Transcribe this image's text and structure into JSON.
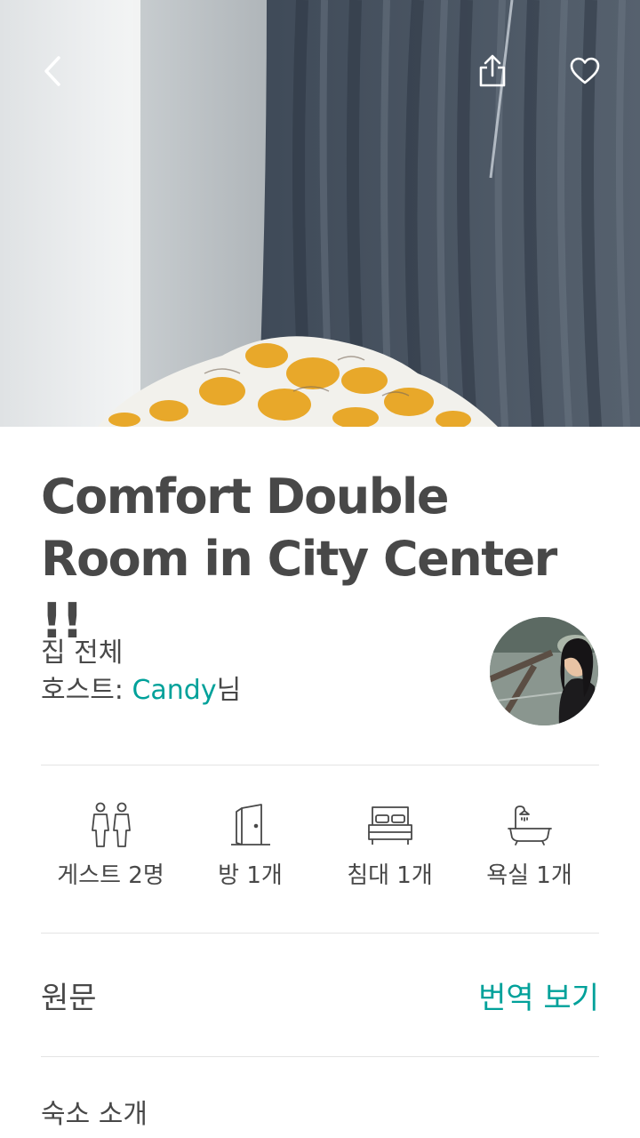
{
  "listing": {
    "title": "Comfort Double Room in City Center !!",
    "room_type": "집 전체",
    "host_prefix": "호스트: ",
    "host_name": "Candy",
    "host_suffix": "님"
  },
  "icons": {
    "back": "chevron-left-icon",
    "share": "share-icon",
    "save": "heart-icon"
  },
  "amenities": [
    {
      "icon": "guests-icon",
      "label": "게스트 2명"
    },
    {
      "icon": "door-icon",
      "label": "방 1개"
    },
    {
      "icon": "bed-icon",
      "label": "침대 1개"
    },
    {
      "icon": "bathtub-icon",
      "label": "욕실 1개"
    }
  ],
  "translation": {
    "original_label": "원문",
    "translate_link": "번역 보기"
  },
  "sections": {
    "description_title": "숙소 소개"
  },
  "colors": {
    "accent": "#00a19a",
    "text": "#484848",
    "divider": "#e4e4e4"
  }
}
